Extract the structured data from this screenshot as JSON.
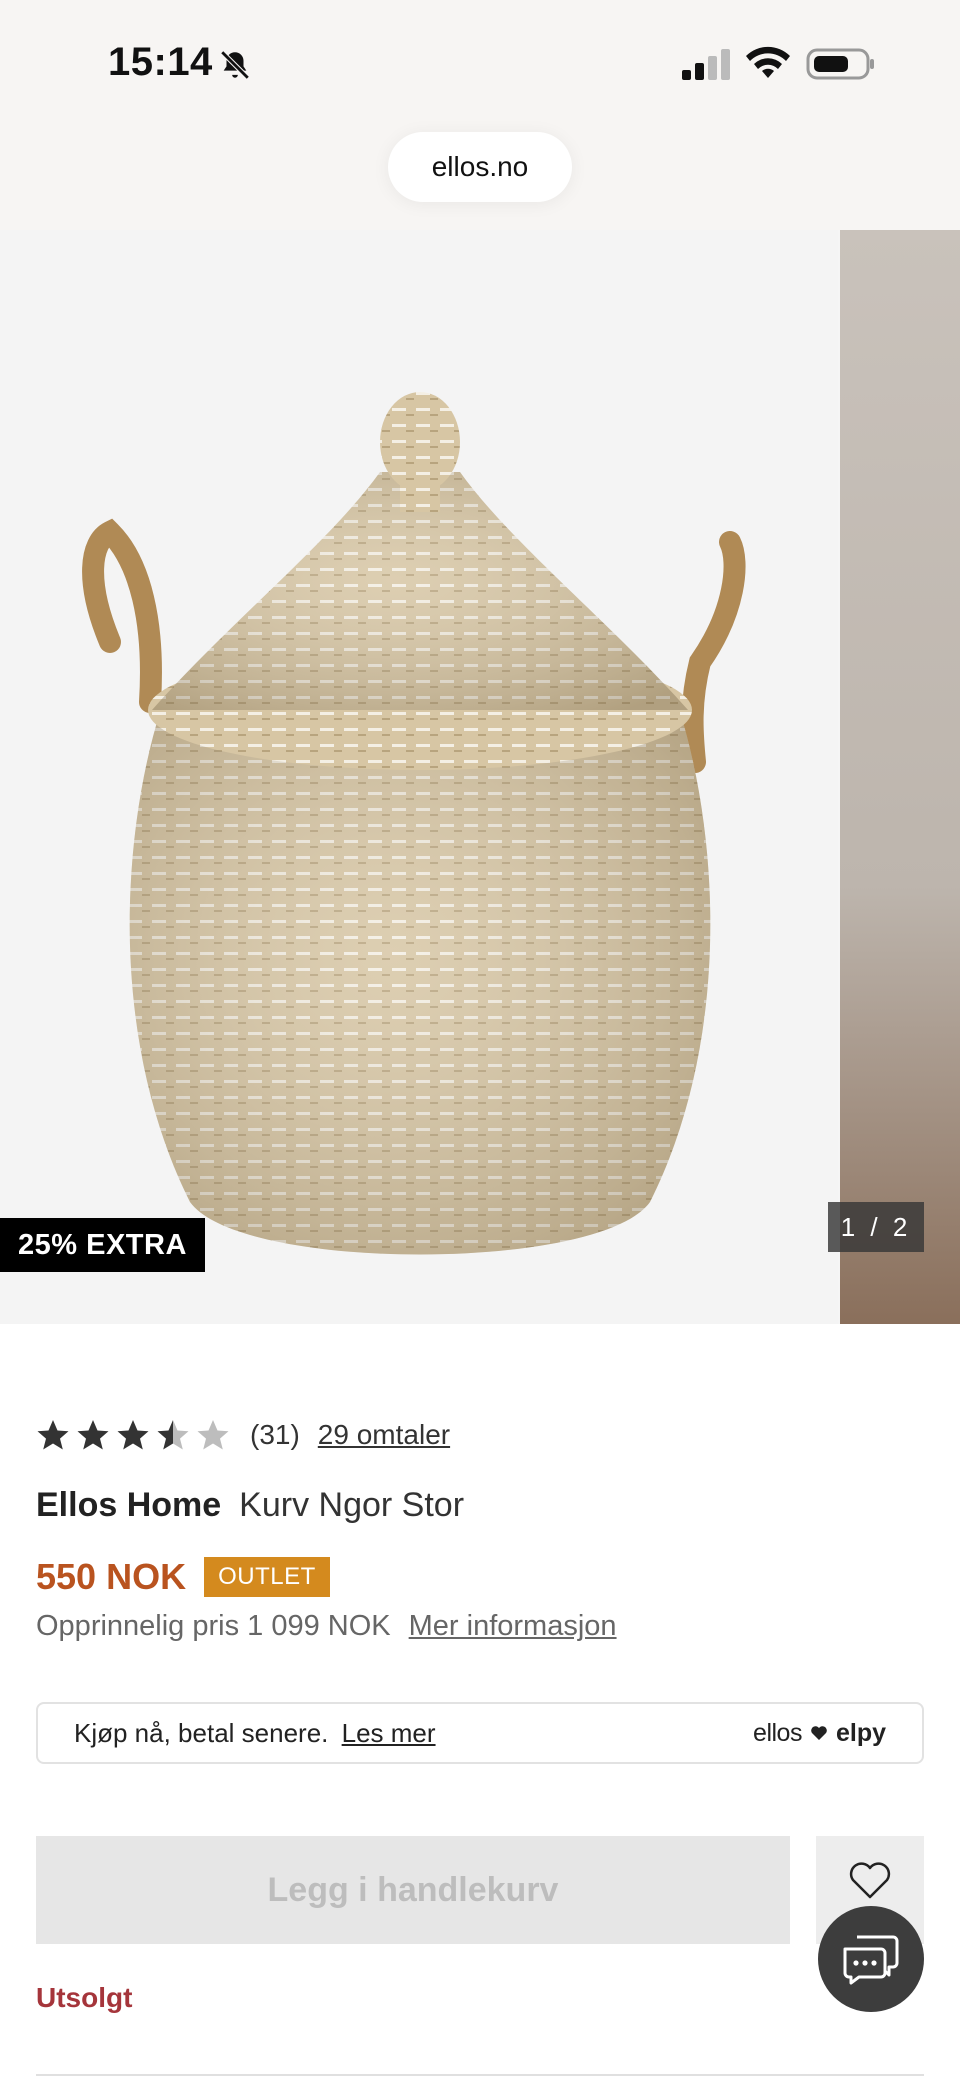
{
  "status_bar": {
    "time": "15:14",
    "icons": [
      "bell-slash-icon",
      "cellular-signal-icon",
      "wifi-icon",
      "battery-icon"
    ]
  },
  "browser": {
    "url": "ellos.no"
  },
  "gallery": {
    "badge": "25% EXTRA",
    "counter": "1 / 2"
  },
  "product": {
    "rating": {
      "stars_filled": 3.5,
      "stars_total": 5,
      "count": "(31)",
      "reviews_link": "29 omtaler"
    },
    "brand": "Ellos Home",
    "name": "Kurv Ngor Stor",
    "price": "550 NOK",
    "badge": "OUTLET",
    "original_price": "Opprinnelig pris 1 099 NOK",
    "more_info_link": "Mer informasjon"
  },
  "bnpl": {
    "text": "Kjøp nå, betal senere.",
    "link": "Les mer",
    "logo_left": "ellos",
    "logo_right": "elpy"
  },
  "actions": {
    "add_to_cart": "Legg i handlekurv",
    "stock_status": "Utsolgt"
  },
  "colors": {
    "price": "#b9531f",
    "outlet_badge": "#d48a1e",
    "sold_out": "#a5353b",
    "button_disabled_bg": "#e6e6e6",
    "chat_button": "#3d3d3d"
  }
}
